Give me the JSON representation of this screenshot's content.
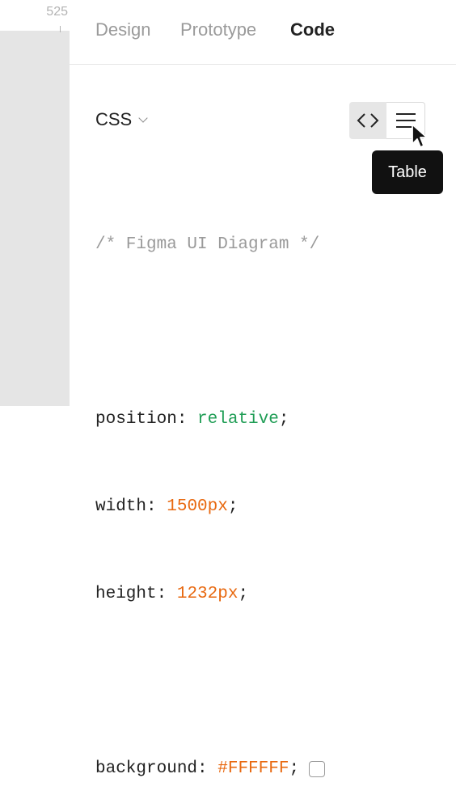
{
  "ruler": {
    "value": "525"
  },
  "tabs": [
    {
      "label": "Design",
      "active": false
    },
    {
      "label": "Prototype",
      "active": false
    },
    {
      "label": "Code",
      "active": true
    }
  ],
  "language_select": {
    "value": "CSS"
  },
  "view_toggle": {
    "selected": "code",
    "options": [
      "code",
      "table"
    ],
    "icons": {
      "code": "code-brackets-icon",
      "table": "table-lines-icon"
    }
  },
  "tooltip": {
    "text": "Table"
  },
  "code": {
    "comment": "/* Figma UI Diagram */",
    "position_prop": "position",
    "position_val": "relative",
    "width_prop": "width",
    "width_val": "1500px",
    "height_prop": "height",
    "height_val": "1232px",
    "background_prop": "background",
    "background_val": "#FFFFFF",
    "colon": ": ",
    "semicolon": ";"
  },
  "colors": {
    "keyword": "#1f9d55",
    "value": "#e8680f",
    "comment": "#9a9a9a",
    "swatch": "#FFFFFF"
  }
}
